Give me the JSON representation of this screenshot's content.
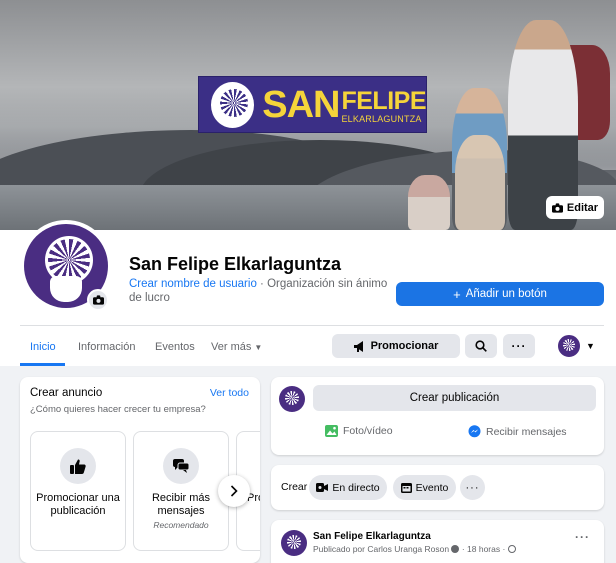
{
  "colors": {
    "accent": "#1877f2",
    "brand_purple": "#3b2f86",
    "brand_yellow": "#f5d43a"
  },
  "cover": {
    "banner_main": "SAN",
    "banner_second": "FELIPE",
    "banner_sub": "ELKARLAGUNTZA",
    "edit_label": "Editar"
  },
  "profile": {
    "name": "San Felipe Elkarlaguntza",
    "username_link": "Crear nombre de usuario",
    "category": "· Organización sin ánimo de lucro",
    "add_button": "Añadir un botón"
  },
  "tabs": [
    {
      "label": "Inicio"
    },
    {
      "label": "Información"
    },
    {
      "label": "Eventos"
    },
    {
      "label": "Ver más"
    }
  ],
  "actions": {
    "promote": "Promocionar"
  },
  "ad_card": {
    "title": "Crear anuncio",
    "link": "Ver todo",
    "subtitle": "¿Cómo quieres hacer crecer tu empresa?",
    "options": [
      {
        "label": "Promocionar una publicación",
        "sub": ""
      },
      {
        "label": "Recibir más mensajes",
        "sub": "Recomendado"
      },
      {
        "label": "Pro",
        "sub": ""
      }
    ]
  },
  "composer": {
    "create_post": "Crear publicación",
    "photo_video": "Foto/vídeo",
    "get_messages": "Recibir mensajes"
  },
  "create_bar": {
    "label": "Crear",
    "live": "En directo",
    "event": "Evento"
  },
  "post": {
    "author": "San Felipe Elkarlaguntza",
    "meta": "Publicado por Carlos Uranga Roson",
    "time": "· 18 horas ·"
  }
}
